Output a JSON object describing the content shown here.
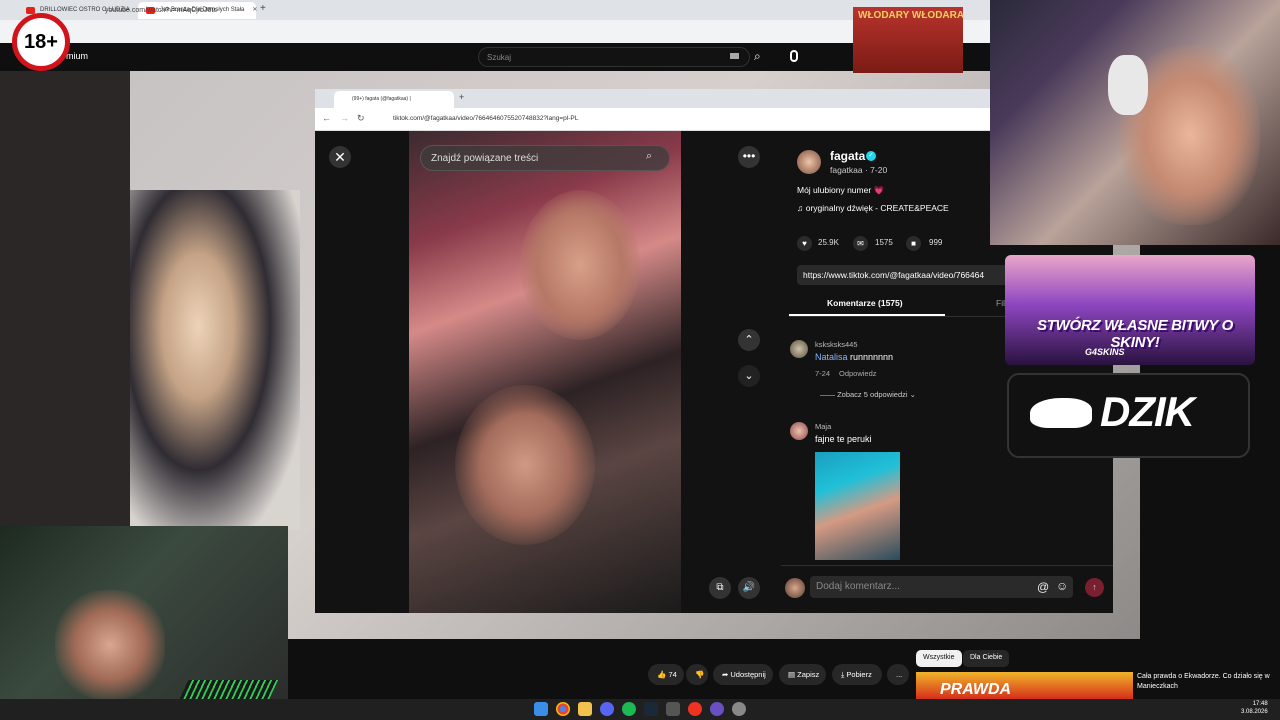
{
  "outer_browser": {
    "tabs": [
      "DRILLOWIEC OSTRO O LUDZIA",
      "Jak Branża Dla Dorosłych Stała"
    ],
    "url": "youtube.com/watch?v=mAqCjrbJ6ts",
    "add_tab": "+"
  },
  "youtube": {
    "logo_suffix": "mium",
    "search_placeholder": "Szukaj",
    "age_badge": "18+",
    "actions": {
      "likes": "74",
      "share": "Udostępnij",
      "save": "Zapisz",
      "download": "Pobierz",
      "more": "..."
    },
    "chips": [
      "Wszystkie",
      "Dla Ciebie"
    ],
    "next_video_title": "Cała prawda o Ekwadorze. Co działo się w Manieczkach",
    "next_video_thumb_text": "PRAWDA"
  },
  "tiktok_browser": {
    "tab_title": "(99+) fagata (@fagatkaa) |",
    "url": "tiktok.com/@fagatkaa/video/7664646075520748832?lang=pl-PL"
  },
  "tiktok": {
    "search_placeholder": "Znajdź powiązane treści",
    "username": "fagata",
    "handle": "fagatkaa · 7-20",
    "description": "Mój ulubiony numer 💗",
    "sound": "♫ oryginalny dźwięk - CREATE&PEACE",
    "likes": "25.9K",
    "comments_count": "1575",
    "saves": "999",
    "link": "https://www.tiktok.com/@fagatkaa/video/766464",
    "tab_comments": "Komentarze (1575)",
    "tab_films": "Filmy",
    "comments": [
      {
        "user": "ksksksks445",
        "mention": "Natalisa",
        "text": " runnnnnnn",
        "date": "7-24",
        "reply": "Odpowiedz",
        "view_replies": "—— Zobacz 5 odpowiedzi ⌄"
      },
      {
        "user": "Maja",
        "text": "fajne te peruki"
      }
    ],
    "comment_placeholder": "Dodaj komentarz...",
    "icons": {
      "close": "✕",
      "search": "⌕",
      "more": "•••",
      "up": "⌃",
      "down": "⌄",
      "at": "@",
      "emoji": "☺",
      "send": "↑"
    }
  },
  "overlays": {
    "banner_top": "WŁODARY WŁODARA",
    "g4_title": "STWÓRZ WŁASNE BITWY O SKINY!",
    "g4_brand": "G4SKINS",
    "dzik": "DZIK"
  },
  "taskbar": {
    "time": "17:48",
    "date": "3.08.2026"
  }
}
